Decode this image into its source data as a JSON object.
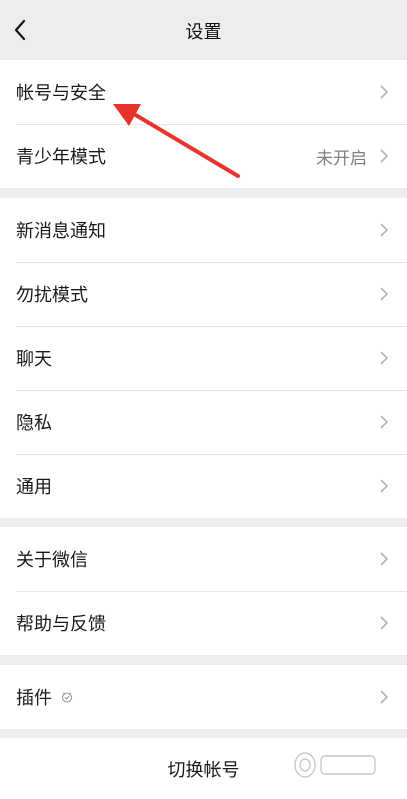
{
  "header": {
    "title": "设置",
    "back_icon": "chevron-left-icon"
  },
  "groups": [
    {
      "items": [
        {
          "label": "帐号与安全",
          "value": ""
        },
        {
          "label": "青少年模式",
          "value": "未开启"
        }
      ]
    },
    {
      "items": [
        {
          "label": "新消息通知",
          "value": ""
        },
        {
          "label": "勿扰模式",
          "value": ""
        },
        {
          "label": "聊天",
          "value": ""
        },
        {
          "label": "隐私",
          "value": ""
        },
        {
          "label": "通用",
          "value": ""
        }
      ]
    },
    {
      "items": [
        {
          "label": "关于微信",
          "value": ""
        },
        {
          "label": "帮助与反馈",
          "value": ""
        }
      ]
    },
    {
      "items": [
        {
          "label": "插件",
          "value": "",
          "icon": "plugin-icon"
        }
      ]
    }
  ],
  "footer": {
    "switch_account_label": "切换帐号"
  },
  "annotation": {
    "arrow_color": "#e8332d"
  }
}
